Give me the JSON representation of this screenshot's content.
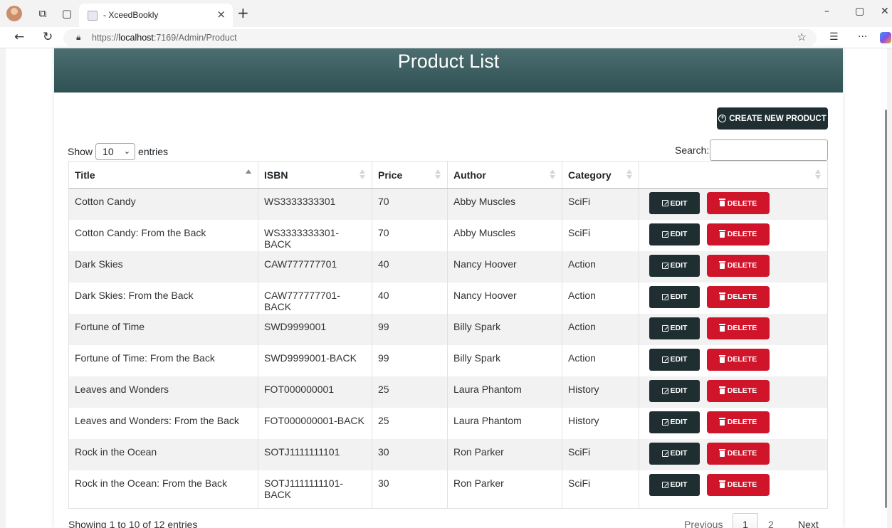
{
  "browser": {
    "tab_title": "- XceedBookly",
    "url_prefix": "https://",
    "url_host": "localhost",
    "url_rest": ":7169/Admin/Product",
    "icons": [
      "avatar",
      "workspaces-icon",
      "tab-actions-icon",
      "close-icon",
      "new-tab-icon",
      "back-icon",
      "refresh-icon",
      "lock-icon",
      "star-icon",
      "favorites-icon",
      "more-icon",
      "copilot-icon"
    ]
  },
  "page": {
    "title": "Product List",
    "create_button": "CREATE NEW PRODUCT",
    "show_label": "Show",
    "entries_value": "10",
    "entries_label": "entries",
    "search_label": "Search:",
    "search_value": ""
  },
  "table": {
    "columns": [
      "Title",
      "ISBN",
      "Price",
      "Author",
      "Category",
      ""
    ],
    "rows": [
      {
        "title": "Cotton Candy",
        "isbn": "WS3333333301",
        "price": "70",
        "author": "Abby Muscles",
        "category": "SciFi"
      },
      {
        "title": "Cotton Candy: From the Back",
        "isbn": "WS3333333301-BACK",
        "price": "70",
        "author": "Abby Muscles",
        "category": "SciFi"
      },
      {
        "title": "Dark Skies",
        "isbn": "CAW777777701",
        "price": "40",
        "author": "Nancy Hoover",
        "category": "Action"
      },
      {
        "title": "Dark Skies: From the Back",
        "isbn": "CAW777777701-BACK",
        "price": "40",
        "author": "Nancy Hoover",
        "category": "Action"
      },
      {
        "title": "Fortune of Time",
        "isbn": "SWD9999001",
        "price": "99",
        "author": "Billy Spark",
        "category": "Action"
      },
      {
        "title": "Fortune of Time: From the Back",
        "isbn": "SWD9999001-BACK",
        "price": "99",
        "author": "Billy Spark",
        "category": "Action"
      },
      {
        "title": "Leaves and Wonders",
        "isbn": "FOT000000001",
        "price": "25",
        "author": "Laura Phantom",
        "category": "History"
      },
      {
        "title": "Leaves and Wonders: From the Back",
        "isbn": "FOT000000001-BACK",
        "price": "25",
        "author": "Laura Phantom",
        "category": "History"
      },
      {
        "title": "Rock in the Ocean",
        "isbn": "SOTJ1111111101",
        "price": "30",
        "author": "Ron Parker",
        "category": "SciFi"
      },
      {
        "title": "Rock in the Ocean: From the Back",
        "isbn": "SOTJ1111111101-\nBACK",
        "price": "30",
        "author": "Ron Parker",
        "category": "SciFi"
      }
    ],
    "edit_label": "EDIT",
    "delete_label": "DELETE"
  },
  "footer": {
    "info": "Showing 1 to 10 of 12 entries",
    "previous": "Previous",
    "pages": [
      "1",
      "2"
    ],
    "next": "Next"
  },
  "colors": {
    "header_bg": "#3d5f61",
    "dark_button": "#1f2f31",
    "delete_button": "#d0142a"
  }
}
